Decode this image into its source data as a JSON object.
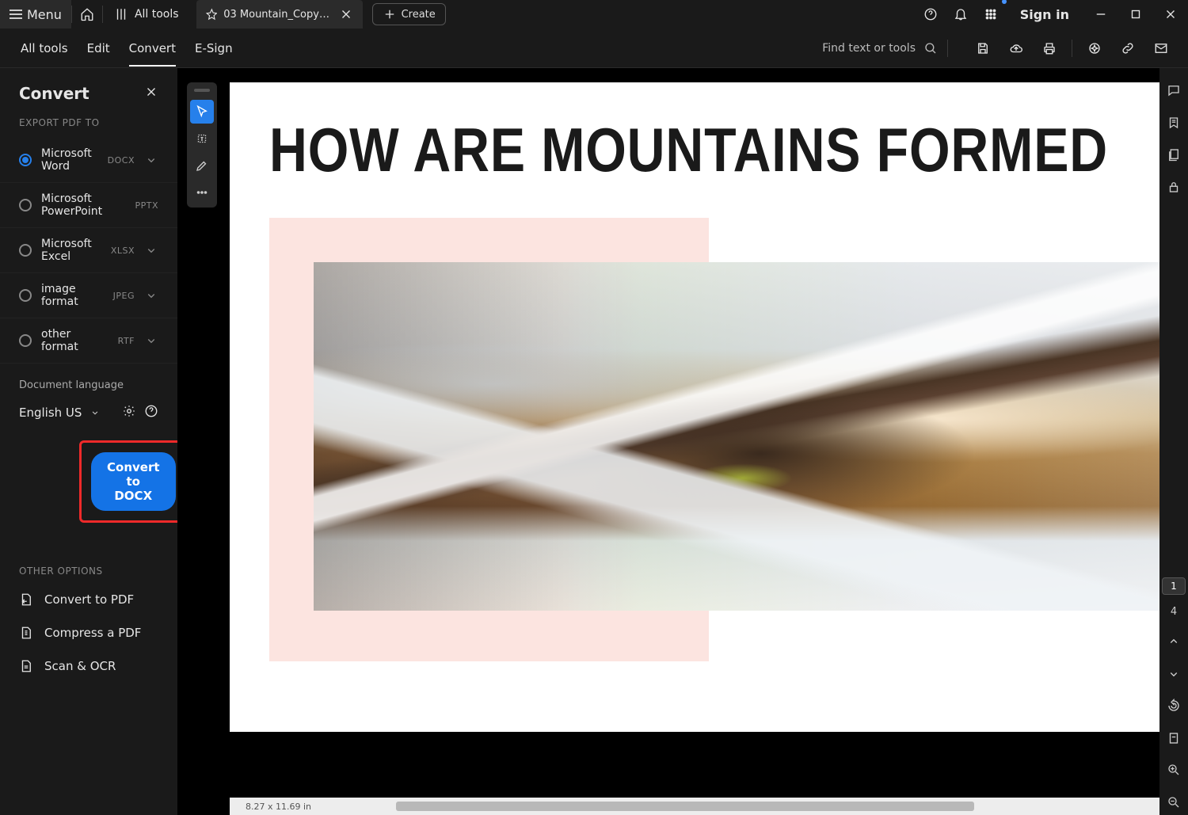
{
  "titlebar": {
    "menu": "Menu",
    "all_tools": "All tools",
    "tab_title": "03 Mountain_Copy (1).p…",
    "create": "Create",
    "sign_in": "Sign in"
  },
  "maintabs": {
    "all_tools": "All tools",
    "edit": "Edit",
    "convert": "Convert",
    "esign": "E-Sign",
    "find": "Find text or tools"
  },
  "panel": {
    "title": "Convert",
    "export_label": "EXPORT PDF TO",
    "options": [
      {
        "label": "Microsoft Word",
        "badge": "DOCX",
        "checked": true,
        "chev": true
      },
      {
        "label": "Microsoft PowerPoint",
        "badge": "PPTX",
        "checked": false,
        "chev": false
      },
      {
        "label": "Microsoft Excel",
        "badge": "XLSX",
        "checked": false,
        "chev": true
      },
      {
        "label": "image format",
        "badge": "JPEG",
        "checked": false,
        "chev": true
      },
      {
        "label": "other format",
        "badge": "RTF",
        "checked": false,
        "chev": true
      }
    ],
    "lang_label": "Document language",
    "lang_value": "English US",
    "cta": "Convert to DOCX",
    "other_label": "OTHER OPTIONS",
    "other": [
      "Convert to PDF",
      "Compress a PDF",
      "Scan & OCR"
    ]
  },
  "doc": {
    "heading": "HOW ARE MOUNTAINS FORMED",
    "page_dims": "8.27 x 11.69 in"
  },
  "pagenav": {
    "current": "1",
    "total": "4"
  }
}
